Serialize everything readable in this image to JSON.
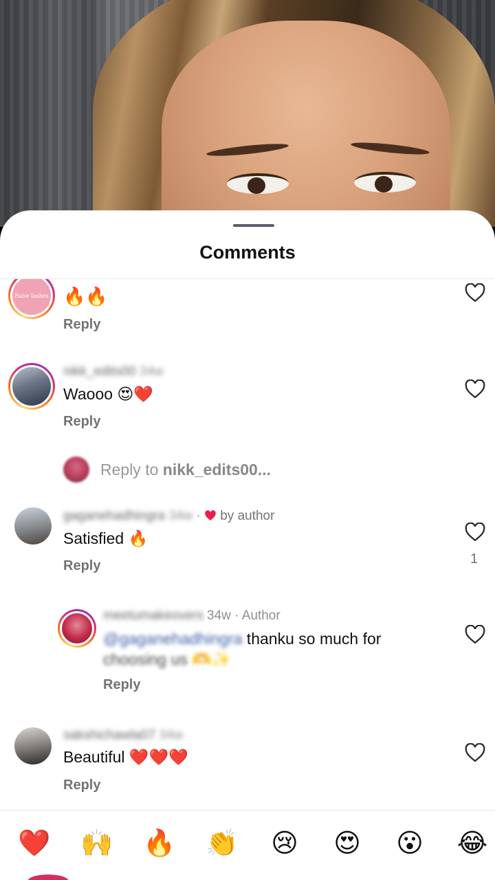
{
  "sheet": {
    "title": "Comments"
  },
  "comments": [
    {
      "id": "c0",
      "avatar_label": "False lashes",
      "text": "🔥🔥",
      "reply_label": "Reply"
    },
    {
      "id": "c1",
      "username": "nikk_edits00",
      "time": "34w",
      "text": "Waooo 😍❤️",
      "reply_label": "Reply",
      "reply_to_prefix": "Reply to ",
      "reply_to_user": "nikk_edits00..."
    },
    {
      "id": "c2",
      "username": "gaganehadhingra",
      "time": "34w",
      "liked_by_author": "by author",
      "text": "Satisfied 🔥",
      "reply_label": "Reply",
      "like_count": "1"
    },
    {
      "id": "c3",
      "username": "meetumakeovers",
      "time": "34w",
      "author_tag": "Author",
      "mention": "@gaganehadhingra",
      "text_line1": " thanku so much for",
      "text_line2": "choosing us 🫶✨",
      "reply_label": "Reply"
    },
    {
      "id": "c4",
      "username": "sakshichawla07",
      "time": "34w",
      "text": "Beautiful ❤️❤️❤️",
      "reply_label": "Reply"
    }
  ],
  "reactions": [
    "❤️",
    "🙌",
    "🔥",
    "👏",
    "😢",
    "😍",
    "😮",
    "😂"
  ],
  "colors": {
    "heart_red": "#ed1c4a",
    "link_blue": "#3b5ea8",
    "muted": "#737373"
  }
}
